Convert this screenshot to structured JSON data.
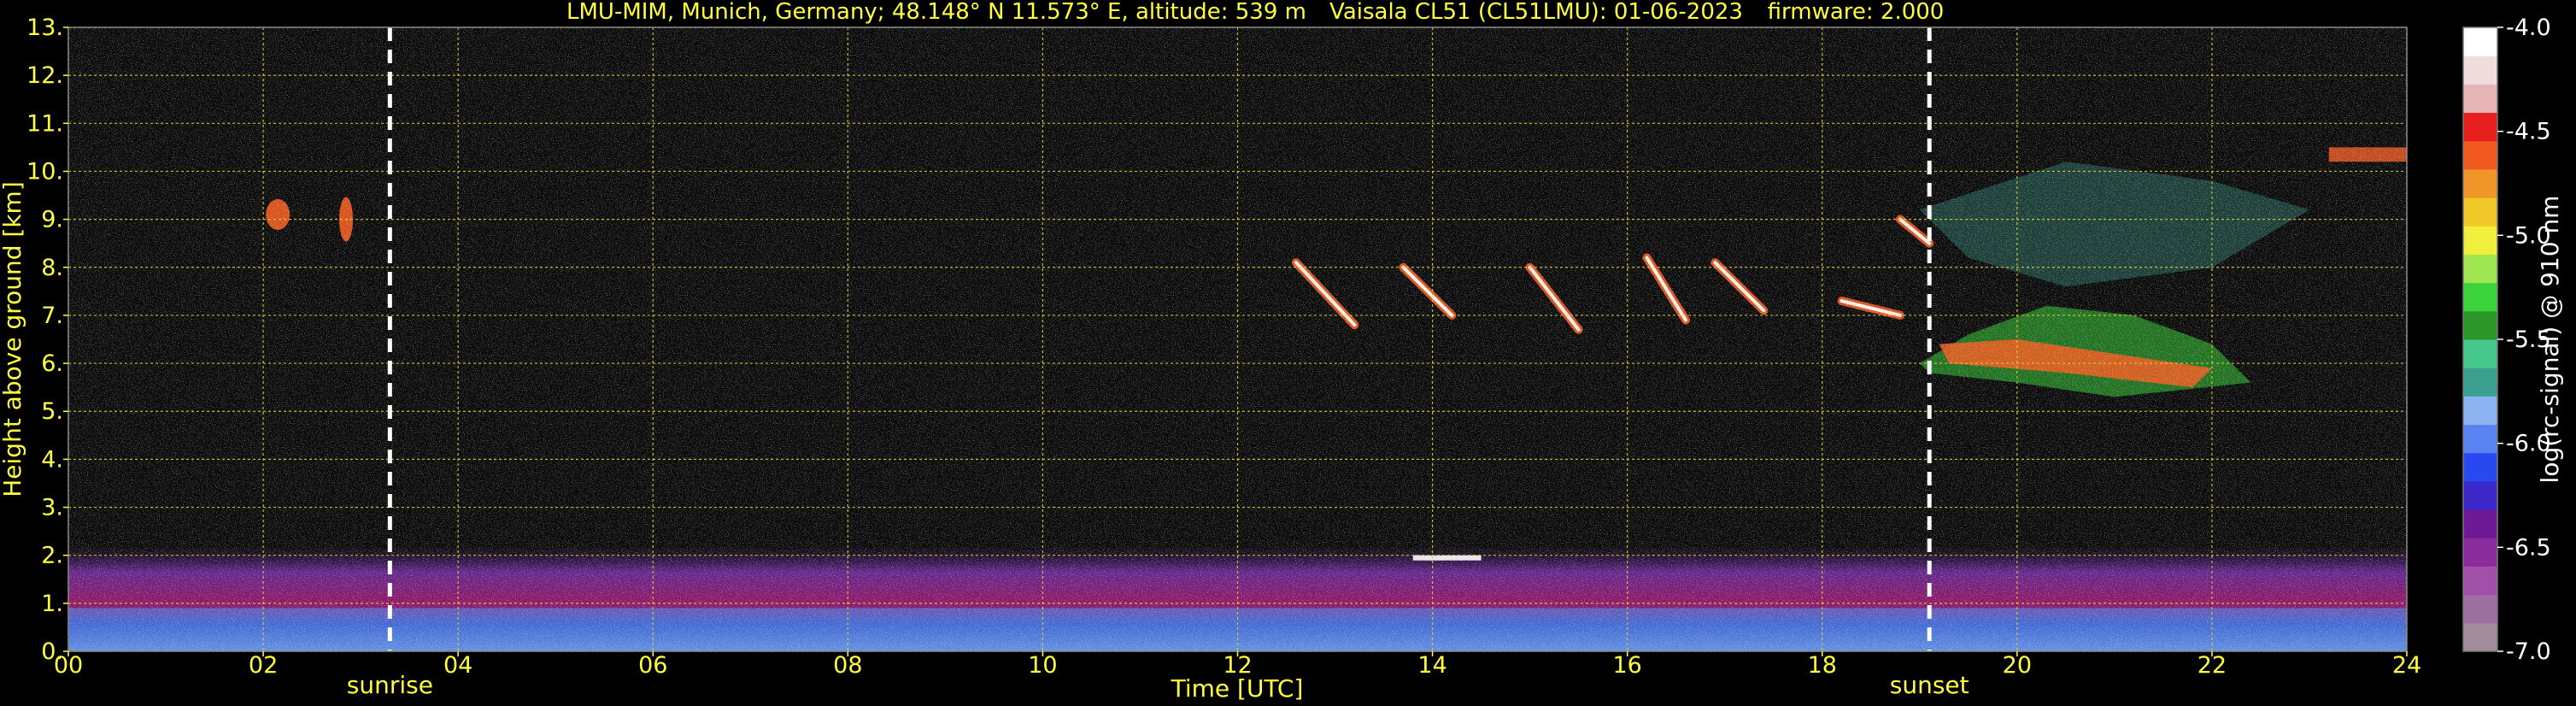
{
  "header": {
    "station": "LMU-MIM, Munich, Germany; 48.148° N 11.573° E, altitude: 539 m",
    "instrument": "Vaisala CL51 (CL51LMU): 01-06-2023",
    "firmware": "firmware: 2.000"
  },
  "colors": {
    "text_primary": "#ffff3c",
    "grid": "#e6d23c",
    "background": "#000000",
    "marker_line": "#ffffff"
  },
  "chart_data": {
    "type": "heatmap",
    "title": "LMU-MIM, Munich, Germany; 48.148° N 11.573° E, altitude: 539 m    Vaisala CL51 (CL51LMU): 01-06-2023    firmware: 2.000",
    "xlabel": "Time [UTC]",
    "ylabel": "Height above ground [km]",
    "xlim": [
      0,
      24
    ],
    "ylim": [
      0,
      13
    ],
    "x_ticks": [
      "00",
      "02",
      "04",
      "06",
      "08",
      "10",
      "12",
      "14",
      "16",
      "18",
      "20",
      "22",
      "24"
    ],
    "y_ticks": [
      "0.",
      "1.",
      "2.",
      "3.",
      "4.",
      "5.",
      "6.",
      "7.",
      "8.",
      "9.",
      "10.",
      "11.",
      "12.",
      "13."
    ],
    "grid": true,
    "markers": [
      {
        "label": "sunrise",
        "x": 3.3
      },
      {
        "label": "sunset",
        "x": 19.1
      }
    ],
    "colorbar": {
      "label": "log(rc-signal) @ 910 nm",
      "ticks": [
        "-4.0",
        "-4.5",
        "-5.0",
        "-5.5",
        "-6.0",
        "-6.5",
        "-7.0"
      ],
      "range": [
        -7.0,
        -4.0
      ],
      "colors": [
        "#a08c9a",
        "#9c6fa0",
        "#a050a8",
        "#8c2c9c",
        "#6e1a96",
        "#3c28c8",
        "#2a48f0",
        "#5a82f0",
        "#8cb4f0",
        "#3ca090",
        "#46c88c",
        "#2a9628",
        "#3cd23c",
        "#a0e650",
        "#f0f03c",
        "#f0c828",
        "#f09628",
        "#f05a1e",
        "#e61e1e",
        "#e6b4b4",
        "#f0dcdc",
        "#ffffff"
      ]
    },
    "features": [
      {
        "name": "boundary layer aerosol",
        "x_range": [
          0,
          24
        ],
        "height_km": [
          0,
          2.2
        ]
      },
      {
        "name": "cirrus cloud",
        "x_range": [
          1.9,
          3.0
        ],
        "height_km": [
          8.5,
          9.6
        ]
      },
      {
        "name": "cirrus cloud streaks",
        "x_range": [
          11.0,
          19.0
        ],
        "height_km": [
          6.5,
          9.0
        ]
      },
      {
        "name": "cirrus cloud deck",
        "x_range": [
          19.0,
          24.0
        ],
        "height_km": [
          5.2,
          10.5
        ]
      },
      {
        "name": "boundary layer top clouds",
        "x_range": [
          13.8,
          14.5
        ],
        "height_km": [
          1.9,
          2.0
        ]
      }
    ]
  }
}
